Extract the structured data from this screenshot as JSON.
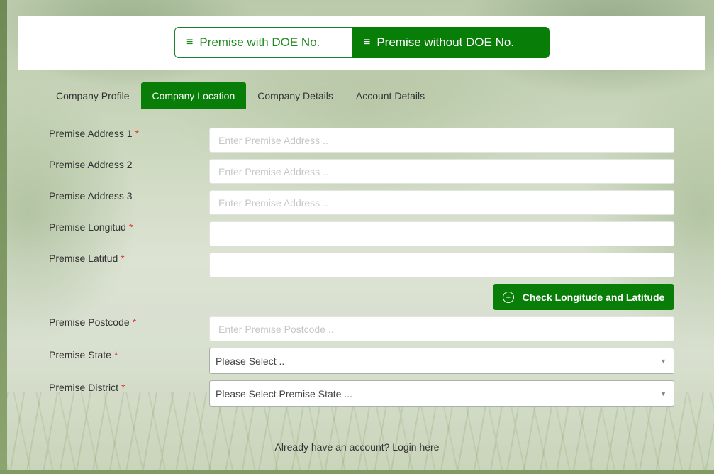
{
  "registration_type": {
    "with_doe": "Premise with DOE No.",
    "without_doe": "Premise without DOE No."
  },
  "tabs": [
    {
      "label": "Company Profile",
      "active": false
    },
    {
      "label": "Company Location",
      "active": true
    },
    {
      "label": "Company Details",
      "active": false
    },
    {
      "label": "Account Details",
      "active": false
    }
  ],
  "form": {
    "address1": {
      "label": "Premise Address 1",
      "required": "*",
      "placeholder": "Enter Premise Address ..",
      "value": ""
    },
    "address2": {
      "label": "Premise Address 2",
      "placeholder": "Enter Premise Address ..",
      "value": ""
    },
    "address3": {
      "label": "Premise Address 3",
      "placeholder": "Enter Premise Address ..",
      "value": ""
    },
    "longitud": {
      "label": "Premise Longitud",
      "required": "*",
      "value": ""
    },
    "latitud": {
      "label": "Premise Latitud",
      "required": "*",
      "value": ""
    },
    "check_button": "Check Longitude and Latitude",
    "postcode": {
      "label": "Premise Postcode",
      "required": "*",
      "placeholder": "Enter Premise Postcode ..",
      "value": ""
    },
    "state": {
      "label": "Premise State",
      "required": "*",
      "selected": "Please Select .."
    },
    "district": {
      "label": "Premise District",
      "required": "*",
      "selected": "Please Select Premise State ..."
    }
  },
  "login_prompt": "Already have an account? Login here",
  "colors": {
    "accent": "#087d08",
    "required": "#e0332c"
  },
  "icons": {
    "list": "list-icon",
    "plus_circle": "plus-circle-icon",
    "caret": "caret-down-icon"
  }
}
